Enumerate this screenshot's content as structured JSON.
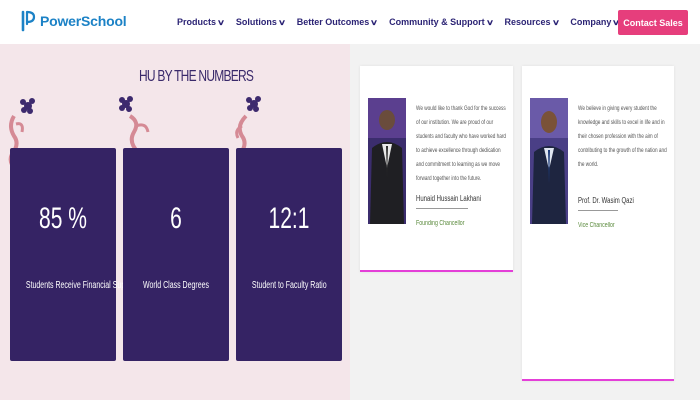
{
  "brand": {
    "name": "PowerSchool",
    "color": "#1c82c6"
  },
  "nav": {
    "items": [
      {
        "label": "Products"
      },
      {
        "label": "Solutions"
      },
      {
        "label": "Better Outcomes"
      },
      {
        "label": "Community & Support"
      },
      {
        "label": "Resources"
      },
      {
        "label": "Company"
      }
    ],
    "cta_label": "Contact Sales"
  },
  "numbers": {
    "title": "HU BY THE NUMBERS",
    "stats": [
      {
        "value": "85 %",
        "label": "Students Receive Financial Support"
      },
      {
        "value": "6",
        "label": "World Class Degrees"
      },
      {
        "value": "12:1",
        "label": "Student to Faculty Ratio"
      }
    ]
  },
  "leaders": [
    {
      "quote": "We would like to thank God for the success of our institution. We are proud of our students and faculty who have worked hard to achieve excellence through dedication and commitment to learning as we move forward together into the future.",
      "name": "Hunaid Hussain Lakhani",
      "title": "Founding Chancellor"
    },
    {
      "quote": "We believe in giving every student the knowledge and skills to excel in life and in their chosen profession with the aim of contributing to the growth of the nation and the world.",
      "name": "Prof. Dr. Wasim Qazi",
      "title": "Vice Chancellor"
    }
  ],
  "colors": {
    "nav_text": "#2c2475",
    "cta_bg": "#e63e7c",
    "stat_card": "#352364",
    "left_bg": "#f4e6ea",
    "accent_bar": "#e43fd8"
  }
}
